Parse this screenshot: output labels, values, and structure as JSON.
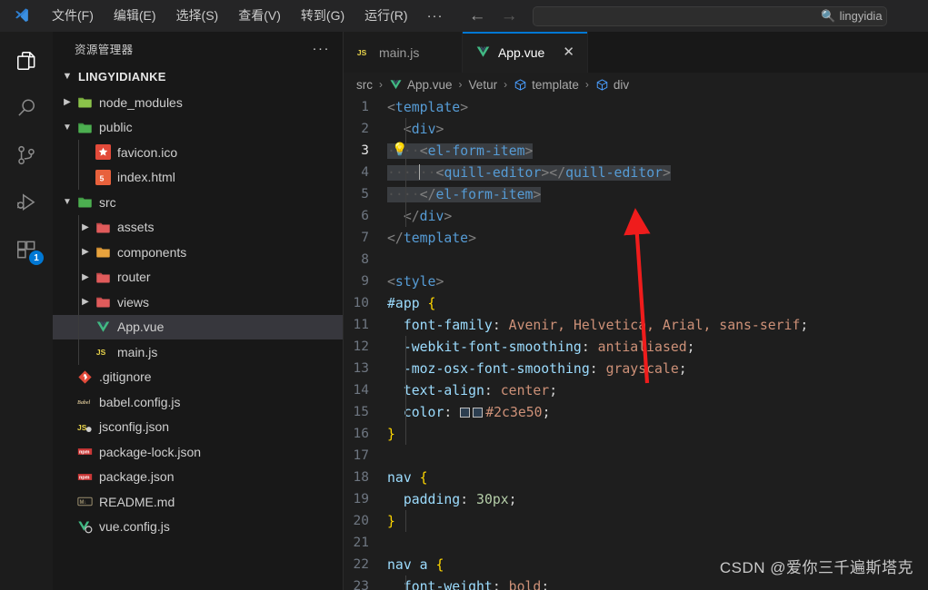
{
  "titlebar": {
    "logo_icon": "vscode-logo-icon",
    "menus": [
      "文件(F)",
      "编辑(E)",
      "选择(S)",
      "查看(V)",
      "转到(G)",
      "运行(R)",
      "···"
    ],
    "back_icon": "arrow-left-icon",
    "forward_icon": "arrow-right-icon",
    "search_icon": "search-icon",
    "search_value": "lingyidia",
    "search_placeholder": ""
  },
  "activitybar": {
    "items": [
      {
        "name": "explorer",
        "icon": "files-icon",
        "active": true,
        "badge": ""
      },
      {
        "name": "search",
        "icon": "search-icon",
        "active": false,
        "badge": ""
      },
      {
        "name": "source-control",
        "icon": "source-control-icon",
        "active": false,
        "badge": ""
      },
      {
        "name": "run-debug",
        "icon": "run-debug-icon",
        "active": false,
        "badge": ""
      },
      {
        "name": "extensions",
        "icon": "extensions-icon",
        "active": false,
        "badge": "1"
      }
    ]
  },
  "sidebar": {
    "title": "资源管理器",
    "actions_icon": "ellipsis-icon",
    "root": {
      "label": "LINGYIDIANKE",
      "expanded": true
    },
    "items": [
      {
        "label": "node_modules",
        "type": "folder",
        "icon": "folder-node-icon",
        "depth": 1,
        "expanded": false,
        "selected": false
      },
      {
        "label": "public",
        "type": "folder",
        "icon": "folder-public-icon",
        "depth": 1,
        "expanded": true,
        "selected": false
      },
      {
        "label": "favicon.ico",
        "type": "file",
        "icon": "favicon-icon",
        "depth": 2,
        "selected": false
      },
      {
        "label": "index.html",
        "type": "file",
        "icon": "html5-icon",
        "depth": 2,
        "selected": false
      },
      {
        "label": "src",
        "type": "folder",
        "icon": "folder-src-icon",
        "depth": 1,
        "expanded": true,
        "selected": false
      },
      {
        "label": "assets",
        "type": "folder",
        "icon": "folder-assets-icon",
        "depth": 2,
        "expanded": false,
        "selected": false
      },
      {
        "label": "components",
        "type": "folder",
        "icon": "folder-components-icon",
        "depth": 2,
        "expanded": false,
        "selected": false
      },
      {
        "label": "router",
        "type": "folder",
        "icon": "folder-router-icon",
        "depth": 2,
        "expanded": false,
        "selected": false
      },
      {
        "label": "views",
        "type": "folder",
        "icon": "folder-views-icon",
        "depth": 2,
        "expanded": false,
        "selected": false
      },
      {
        "label": "App.vue",
        "type": "file",
        "icon": "vue-icon",
        "depth": 2,
        "selected": true
      },
      {
        "label": "main.js",
        "type": "file",
        "icon": "js-icon",
        "depth": 2,
        "selected": false
      },
      {
        "label": ".gitignore",
        "type": "file",
        "icon": "git-icon",
        "depth": 1,
        "selected": false
      },
      {
        "label": "babel.config.js",
        "type": "file",
        "icon": "babel-icon",
        "depth": 1,
        "selected": false
      },
      {
        "label": "jsconfig.json",
        "type": "file",
        "icon": "jsconfig-icon",
        "depth": 1,
        "selected": false
      },
      {
        "label": "package-lock.json",
        "type": "file",
        "icon": "npm-icon",
        "depth": 1,
        "selected": false
      },
      {
        "label": "package.json",
        "type": "file",
        "icon": "npm-icon",
        "depth": 1,
        "selected": false
      },
      {
        "label": "README.md",
        "type": "file",
        "icon": "markdown-icon",
        "depth": 1,
        "selected": false
      },
      {
        "label": "vue.config.js",
        "type": "file",
        "icon": "vue-config-icon",
        "depth": 1,
        "selected": false
      }
    ]
  },
  "editor": {
    "tabs": [
      {
        "label": "main.js",
        "icon": "js-icon",
        "active": false,
        "close_icon": "close-icon"
      },
      {
        "label": "App.vue",
        "icon": "vue-icon",
        "active": true,
        "close_icon": "close-icon"
      }
    ],
    "breadcrumb": [
      {
        "label": "src",
        "icon": ""
      },
      {
        "label": "App.vue",
        "icon": "vue-icon"
      },
      {
        "label": "Vetur",
        "icon": ""
      },
      {
        "label": "template",
        "icon": "symbol-cube-icon"
      },
      {
        "label": "div",
        "icon": "symbol-cube-icon"
      }
    ],
    "active_line": 3,
    "lightbulb_icon": "lightbulb-icon",
    "color_swatch_hex": "#2c3e50",
    "lines": [
      {
        "n": 1,
        "text": "<template>"
      },
      {
        "n": 2,
        "text": "  <div>"
      },
      {
        "n": 3,
        "text": "    <el-form-item>"
      },
      {
        "n": 4,
        "text": "      <quill-editor></quill-editor>"
      },
      {
        "n": 5,
        "text": "    </el-form-item>"
      },
      {
        "n": 6,
        "text": "  </div>"
      },
      {
        "n": 7,
        "text": "</template>"
      },
      {
        "n": 8,
        "text": ""
      },
      {
        "n": 9,
        "text": "<style>"
      },
      {
        "n": 10,
        "text": "#app {"
      },
      {
        "n": 11,
        "text": "  font-family: Avenir, Helvetica, Arial, sans-serif;"
      },
      {
        "n": 12,
        "text": "  -webkit-font-smoothing: antialiased;"
      },
      {
        "n": 13,
        "text": "  -moz-osx-font-smoothing: grayscale;"
      },
      {
        "n": 14,
        "text": "  text-align: center;"
      },
      {
        "n": 15,
        "text": "  color: #2c3e50;"
      },
      {
        "n": 16,
        "text": "}"
      },
      {
        "n": 17,
        "text": ""
      },
      {
        "n": 18,
        "text": "nav {"
      },
      {
        "n": 19,
        "text": "  padding: 30px;"
      },
      {
        "n": 20,
        "text": "}"
      },
      {
        "n": 21,
        "text": ""
      },
      {
        "n": 22,
        "text": "nav a {"
      },
      {
        "n": 23,
        "text": "  font-weight: bold;"
      }
    ]
  },
  "annotation": {
    "arrow_color": "#ef1c1c",
    "arrow_name": "red-arrow-annotation"
  },
  "watermark": {
    "text": "CSDN @爱你三千遍斯塔克"
  }
}
